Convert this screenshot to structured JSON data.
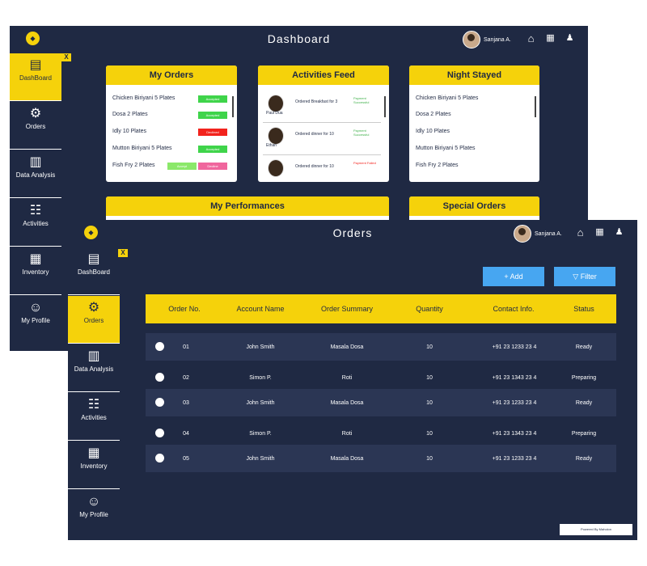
{
  "back": {
    "title": "Dashboard",
    "user": "Sanjana A.",
    "sidebar": [
      {
        "label": "DashBoard",
        "icon": "dashboard-icon"
      },
      {
        "label": "Orders",
        "icon": "orders-icon"
      },
      {
        "label": "Data Analysis",
        "icon": "data-analysis-icon"
      },
      {
        "label": "Activities",
        "icon": "activities-icon"
      },
      {
        "label": "Inventory",
        "icon": "inventory-icon"
      },
      {
        "label": "My Profile",
        "icon": "profile-icon"
      }
    ],
    "close_label": "X",
    "my_orders": {
      "title": "My Orders",
      "rows": [
        {
          "text": "Chicken Biriyani 5 Plates",
          "status": "Accepted",
          "color": "#3fd44a"
        },
        {
          "text": "Dosa 2 Plates",
          "status": "Accepted",
          "color": "#3fd44a"
        },
        {
          "text": "Idly 10 Plates",
          "status": "Declined",
          "color": "#f2231d"
        },
        {
          "text": "Mutton Biriyani 5 Plates",
          "status": "Accepted",
          "color": "#3fd44a"
        },
        {
          "text": "Fish Fry 2 Plates",
          "status": "Accept",
          "status2": "Decline",
          "color": "#8be86a",
          "color2": "#f0669d"
        }
      ]
    },
    "feed": {
      "title": "Activities Feed",
      "rows": [
        {
          "name": "Paul Dua",
          "text": "Ordered Breakfast for 3",
          "pay": "Payment Successful",
          "pay_color": "#3fb04a"
        },
        {
          "name": "Ethan",
          "text": "Ordered dinner for 10",
          "pay": "Payment Successful",
          "pay_color": "#3fb04a"
        },
        {
          "name": "",
          "text": "Ordered dinner for 10",
          "pay": "Payment Failed",
          "pay_color": "#f2231d"
        }
      ]
    },
    "night": {
      "title": "Night Stayed",
      "rows": [
        "Chicken Biriyani 5 Plates",
        "Dosa 2 Plates",
        "Idly 10 Plates",
        "Mutton Biriyani 5 Plates",
        "Fish Fry 2 Plates"
      ]
    },
    "performances_title": "My Performances",
    "special_title": "Special Orders"
  },
  "front": {
    "title": "Orders",
    "user": "Sanjana A.",
    "close_label": "X",
    "sidebar": [
      {
        "label": "DashBoard",
        "icon": "dashboard-icon"
      },
      {
        "label": "Orders",
        "icon": "orders-icon"
      },
      {
        "label": "Data Analysis",
        "icon": "data-analysis-icon"
      },
      {
        "label": "Activities",
        "icon": "activities-icon"
      },
      {
        "label": "Inventory",
        "icon": "inventory-icon"
      },
      {
        "label": "My Profile",
        "icon": "profile-icon"
      }
    ],
    "add_label": "+ Add",
    "filter_label": "Filter",
    "columns": [
      "Order No.",
      "Account Name",
      "Order Summary",
      "Quantity",
      "Contact Info.",
      "Status"
    ],
    "rows": [
      {
        "no": "01",
        "name": "John Smith",
        "summary": "Masala Dosa",
        "qty": "10",
        "contact": "+91 23 1233 23 4",
        "status": "Ready"
      },
      {
        "no": "02",
        "name": "Simon P.",
        "summary": "Roti",
        "qty": "10",
        "contact": "+91 23 1343 23 4",
        "status": "Preparing"
      },
      {
        "no": "03",
        "name": "John Smith",
        "summary": "Masala Dosa",
        "qty": "10",
        "contact": "+91 23 1233 23 4",
        "status": "Ready"
      },
      {
        "no": "04",
        "name": "Simon P.",
        "summary": "Roti",
        "qty": "10",
        "contact": "+91 23 1343 23 4",
        "status": "Preparing"
      },
      {
        "no": "05",
        "name": "John Smith",
        "summary": "Masala Dosa",
        "qty": "10",
        "contact": "+91 23 1233 23 4",
        "status": "Ready"
      }
    ],
    "powered": "Powered By  Maholon",
    "colors": {
      "accent": "#f5d20b",
      "navy": "#1f2943",
      "button": "#47a6f1"
    }
  }
}
